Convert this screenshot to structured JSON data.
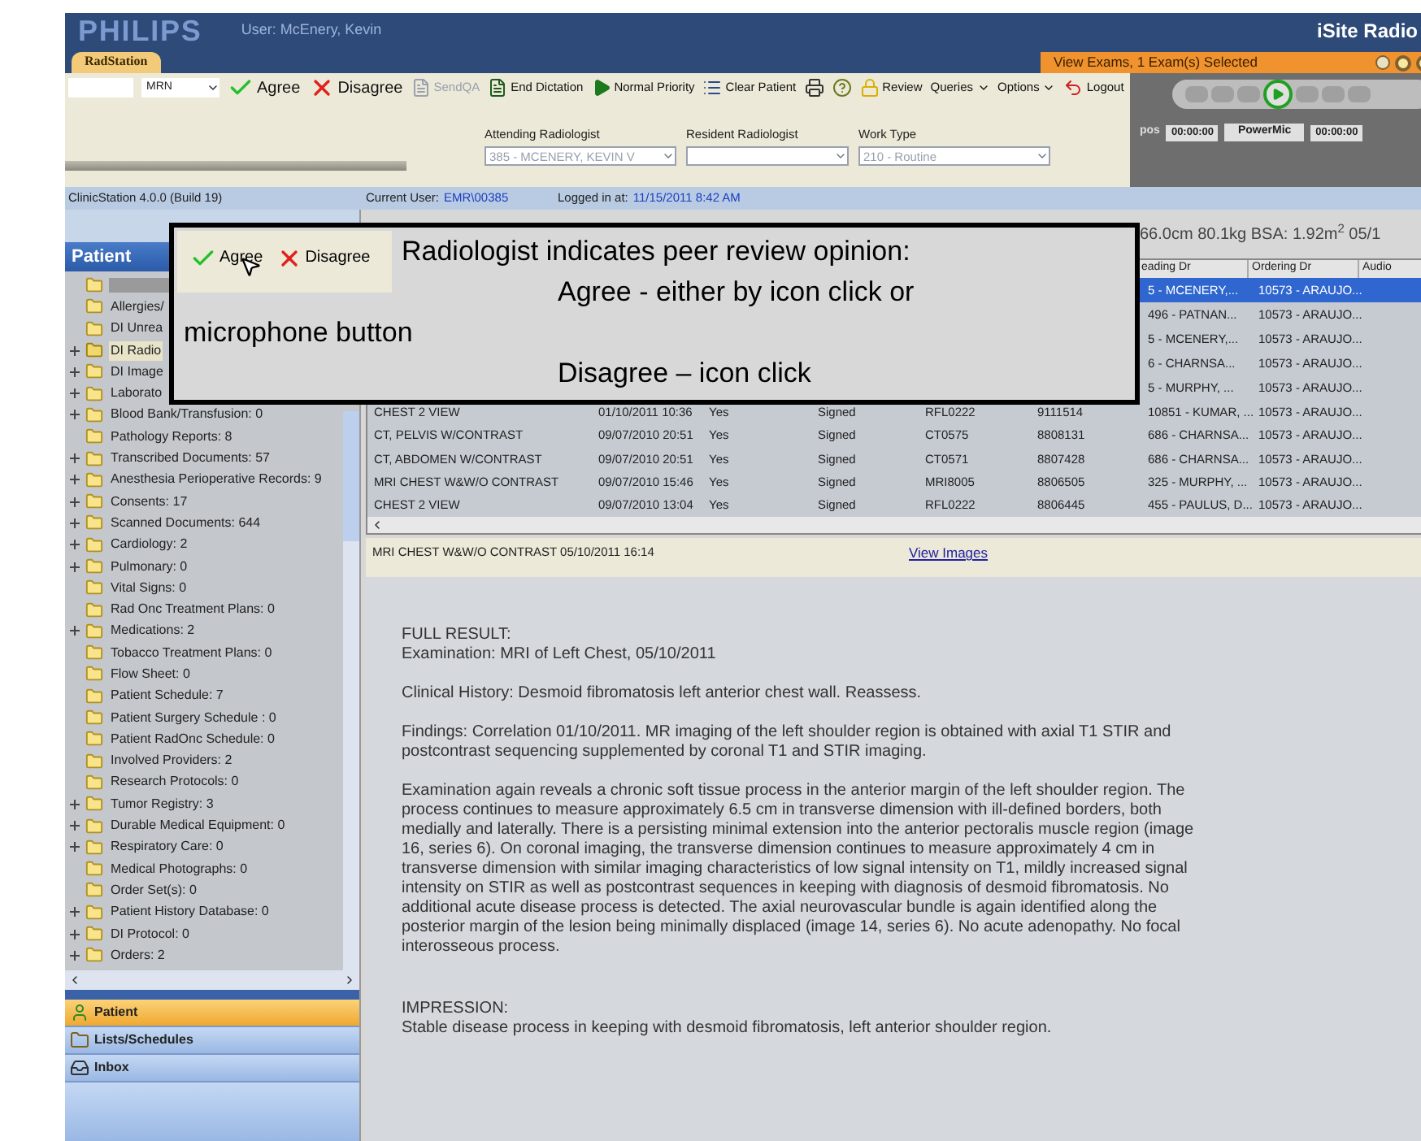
{
  "header": {
    "logo": "PHILIPS",
    "user": "User: McEnery, Kevin",
    "app_tab": "RadStation",
    "product": "iSite Radio",
    "exams_tab": "View Exams, 1 Exam(s) Selected"
  },
  "toolbar": {
    "search_type": "MRN",
    "buttons": [
      {
        "label": "Agree",
        "kind": "agree",
        "disabled": false
      },
      {
        "label": "Disagree",
        "kind": "disagree",
        "disabled": false
      },
      {
        "label": "SendQA",
        "kind": "sendqa",
        "disabled": true
      },
      {
        "label": "End Dictation",
        "kind": "doc",
        "disabled": false
      },
      {
        "label": "Normal Priority",
        "kind": "play",
        "disabled": false
      },
      {
        "label": "Clear Patient",
        "kind": "list",
        "disabled": false
      },
      {
        "label": "Review",
        "kind": "review",
        "disabled": false
      },
      {
        "label": "Queries",
        "kind": "menu",
        "disabled": false
      },
      {
        "label": "Options",
        "kind": "menu",
        "disabled": false
      },
      {
        "label": "Logout",
        "kind": "logout",
        "disabled": false
      }
    ],
    "fields": [
      {
        "label": "Attending Radiologist",
        "value": "385 - MCENERY, KEVIN V"
      },
      {
        "label": "Resident Radiologist"
      },
      {
        "label": "Work Type",
        "value": "210 - Routine"
      }
    ]
  },
  "media": {
    "pos_label": "pos",
    "time_left": "00:00:00",
    "device": "PowerMic",
    "time_right": "00:00:00"
  },
  "status_bar": {
    "version": "ClinicStation 4.0.0 (Build 19)",
    "user_label": "Current User:",
    "user": "EMR\\00385",
    "login_label": "Logged in at:",
    "login_time": "11/15/2011 8:42 AM"
  },
  "sidebar": {
    "title": "Patient",
    "items": [
      {
        "kind": "redacted",
        "expandable": false,
        "selected": false
      },
      {
        "label": "Allergies/",
        "expandable": false,
        "selected": false
      },
      {
        "label": "DI Unrea",
        "expandable": false,
        "selected": false
      },
      {
        "label": "DI Radio",
        "expandable": true,
        "selected": true
      },
      {
        "label": "DI Image",
        "expandable": true,
        "selected": false
      },
      {
        "label": "Laborato",
        "expandable": true,
        "selected": false
      },
      {
        "label": "Blood Bank/Transfusion: 0",
        "expandable": true,
        "selected": false
      },
      {
        "label": "Pathology Reports: 8",
        "expandable": false,
        "selected": false
      },
      {
        "label": "Transcribed Documents: 57",
        "expandable": true,
        "selected": false
      },
      {
        "label": "Anesthesia Perioperative Records: 9",
        "expandable": true,
        "selected": false
      },
      {
        "label": "Consents: 17",
        "expandable": true,
        "selected": false
      },
      {
        "label": "Scanned Documents: 644",
        "expandable": true,
        "selected": false
      },
      {
        "label": "Cardiology: 2",
        "expandable": true,
        "selected": false
      },
      {
        "label": "Pulmonary: 0",
        "expandable": true,
        "selected": false
      },
      {
        "label": "Vital Signs: 0",
        "expandable": false,
        "selected": false
      },
      {
        "label": "Rad Onc Treatment Plans: 0",
        "expandable": false,
        "selected": false
      },
      {
        "label": "Medications: 2",
        "expandable": true,
        "selected": false
      },
      {
        "label": "Tobacco Treatment Plans: 0",
        "expandable": false,
        "selected": false
      },
      {
        "label": "Flow Sheet: 0",
        "expandable": false,
        "selected": false
      },
      {
        "label": "Patient Schedule: 7",
        "expandable": false,
        "selected": false
      },
      {
        "label": "Patient Surgery Schedule : 0",
        "expandable": false,
        "selected": false
      },
      {
        "label": "Patient RadOnc Schedule: 0",
        "expandable": false,
        "selected": false
      },
      {
        "label": "Involved Providers: 2",
        "expandable": false,
        "selected": false
      },
      {
        "label": "Research Protocols: 0",
        "expandable": false,
        "selected": false
      },
      {
        "label": "Tumor Registry: 3",
        "expandable": true,
        "selected": false
      },
      {
        "label": "Durable Medical Equipment: 0",
        "expandable": true,
        "selected": false
      },
      {
        "label": "Respiratory Care: 0",
        "expandable": true,
        "selected": false
      },
      {
        "label": "Medical Photographs: 0",
        "expandable": false,
        "selected": false
      },
      {
        "label": "Order Set(s): 0",
        "expandable": false,
        "selected": false
      },
      {
        "label": "Patient History Database: 0",
        "expandable": true,
        "selected": false
      },
      {
        "label": "DI Protocol: 0",
        "expandable": true,
        "selected": false
      },
      {
        "label": "Orders: 2",
        "expandable": true,
        "selected": false
      }
    ],
    "nav": [
      {
        "label": "Patient",
        "kind": "patient",
        "selected": true
      },
      {
        "label": "Lists/Schedules",
        "kind": "lists",
        "selected": false
      },
      {
        "label": "Inbox",
        "kind": "inbox",
        "selected": false
      }
    ]
  },
  "patient_info": "66.0cm 80.1kg BSA: 1.92m$^{2}$ 05/1",
  "table": {
    "columns": [
      "eading Dr",
      "Ordering Dr",
      "Audio"
    ],
    "rows": [
      {
        "selected": true,
        "cells": {
          "reading_dr": "5 - MCENERY,...",
          "ordering_dr": "10573 - ARAUJO..."
        }
      },
      {
        "selected": false,
        "cells": {
          "reading_dr": "496 - PATNAN...",
          "ordering_dr": "10573 - ARAUJO..."
        }
      },
      {
        "selected": false,
        "cells": {
          "reading_dr": "5 - MCENERY,...",
          "ordering_dr": "10573 - ARAUJO..."
        }
      },
      {
        "selected": false,
        "cells": {
          "reading_dr": "6 - CHARNSA...",
          "ordering_dr": "10573 - ARAUJO..."
        }
      },
      {
        "selected": false,
        "cells": {
          "reading_dr": "5 - MURPHY, ...",
          "ordering_dr": "10573 - ARAUJO..."
        }
      },
      {
        "selected": false,
        "cells": {
          "exam": "CHEST 2 VIEW",
          "date": "01/10/2011 10:36",
          "column_3": "Yes",
          "status": "Signed",
          "code": "RFL0222",
          "number": "9111514",
          "reading_dr": "10851 - KUMAR, ...",
          "ordering_dr": "10573 - ARAUJO..."
        }
      },
      {
        "selected": false,
        "cells": {
          "exam": "CT, PELVIS W/CONTRAST",
          "date": "09/07/2010 20:51",
          "column_3": "Yes",
          "status": "Signed",
          "code": "CT0575",
          "number": "8808131",
          "reading_dr": "686 - CHARNSA...",
          "ordering_dr": "10573 - ARAUJO..."
        }
      },
      {
        "selected": false,
        "cells": {
          "exam": "CT, ABDOMEN W/CONTRAST",
          "date": "09/07/2010 20:51",
          "column_3": "Yes",
          "status": "Signed",
          "code": "CT0571",
          "number": "8807428",
          "reading_dr": "686 - CHARNSA...",
          "ordering_dr": "10573 - ARAUJO..."
        }
      },
      {
        "selected": false,
        "cells": {
          "exam": "MRI CHEST W&W/O CONTRAST",
          "date": "09/07/2010 15:46",
          "column_3": "Yes",
          "status": "Signed",
          "code": "MRI8005",
          "number": "8806505",
          "reading_dr": "325 - MURPHY, ...",
          "ordering_dr": "10573 - ARAUJO..."
        }
      },
      {
        "selected": false,
        "cells": {
          "exam": "CHEST 2 VIEW",
          "date": "09/07/2010 13:04",
          "column_3": "Yes",
          "status": "Signed",
          "code": "RFL0222",
          "number": "8806445",
          "reading_dr": "455 - PAULUS, D...",
          "ordering_dr": "10573 - ARAUJO..."
        }
      }
    ]
  },
  "report": {
    "title": "MRI CHEST W&W/O CONTRAST 05/10/2011 16:14",
    "link": "View Images",
    "paragraphs": [
      [
        "FULL RESULT:",
        "Examination:  MRI of Left Chest, 05/10/2011"
      ],
      [
        "Clinical History:  Desmoid fibromatosis left anterior chest wall. Reassess."
      ],
      [
        "Findings:  Correlation 01/10/2011. MR imaging of the left shoulder region is obtained with axial T1 STIR and postcontrast sequencing supplemented by coronal T1 and STIR imaging."
      ],
      [
        "Examination again reveals a chronic soft tissue process in the anterior margin of the left shoulder region. The process continues to measure approximately 6.5 cm in transverse dimension with ill-defined borders, both medially and laterally. There is a persisting minimal extension into the anterior pectoralis muscle region (image 16, series 6). On coronal imaging, the transverse dimension continues to measure approximately 4 cm in transverse dimension with similar imaging characteristics of low signal intensity on T1, mildly increased signal intensity on STIR as well as postcontrast sequences in keeping with diagnosis of desmoid fibromatosis. No additional acute disease process is detected. The axial neurovascular bundle is again identified along the posterior margin of the lesion being minimally displaced (image 14, series 6). No acute adenopathy. No focal interosseous process."
      ],
      [
        "IMPRESSION:",
        "Stable disease process in keeping with desmoid fibromatosis, left anterior shoulder region."
      ]
    ]
  },
  "callout": {
    "buttons": [
      {
        "label": "Agree",
        "kind": "agree"
      },
      {
        "label": "Disagree",
        "kind": "disagree"
      }
    ],
    "lines": [
      "Radiologist indicates peer review opinion:",
      "Agree - either by icon click or",
      "microphone button",
      "Disagree – icon click"
    ]
  }
}
